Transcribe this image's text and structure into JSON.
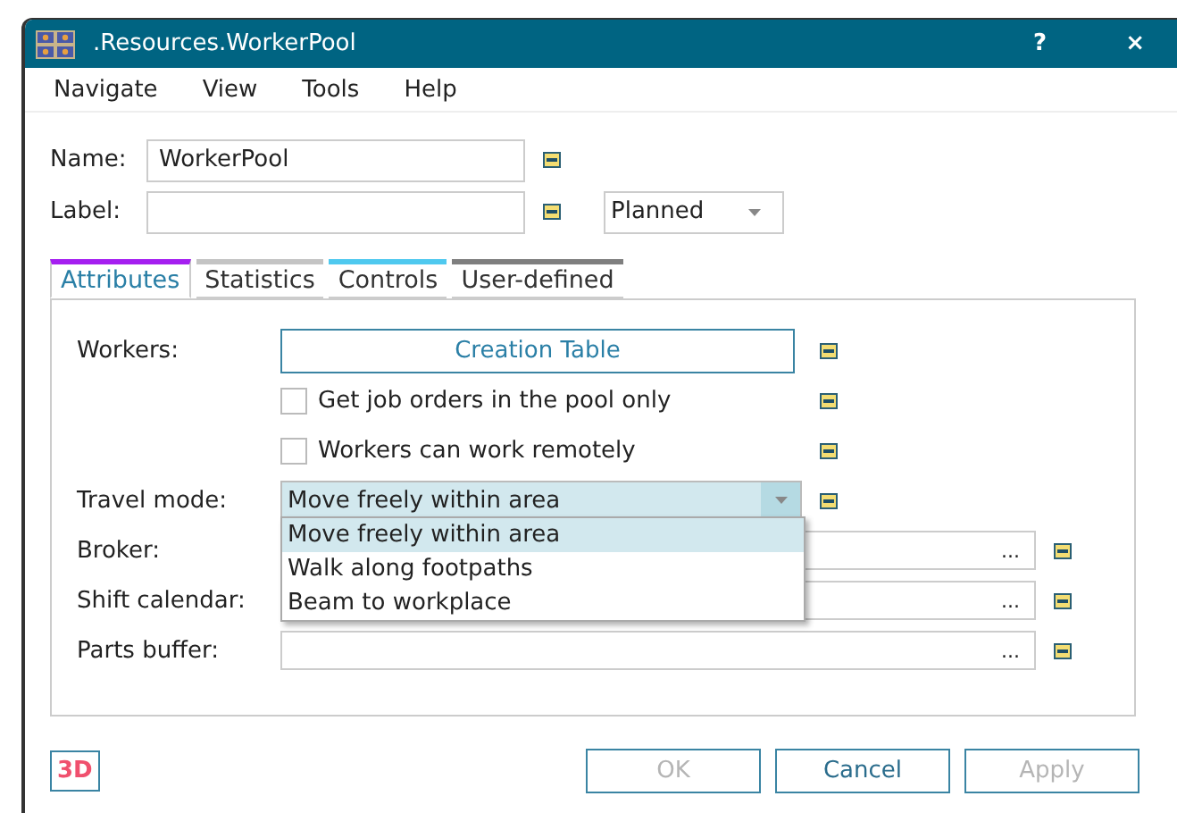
{
  "window": {
    "title": ".Resources.WorkerPool",
    "buttons": [
      "?",
      "×"
    ]
  },
  "menu": [
    "Navigate",
    "View",
    "Tools",
    "Help"
  ],
  "name_field": {
    "label": "Name:",
    "value": "WorkerPool"
  },
  "label_field": {
    "label": "Label:"
  },
  "state_select": {
    "value": "Planned"
  },
  "tabs": [
    {
      "label": "Attributes",
      "selected": true,
      "color": "#a51ff0"
    },
    {
      "label": "Statistics",
      "selected": false,
      "color": "#c4c4c4"
    },
    {
      "label": "Controls",
      "selected": false,
      "color": "#4fc9ef"
    },
    {
      "label": "User-defined",
      "selected": false,
      "color": "#7f7f7f"
    }
  ],
  "attributes": [
    {
      "kind": "button",
      "label": "Workers:",
      "text": "Creation Table"
    },
    {
      "kind": "checkbox",
      "text": "Get job orders in the pool only",
      "checked": false
    },
    {
      "kind": "checkbox",
      "text": "Workers can work remotely",
      "checked": false
    },
    {
      "kind": "select",
      "label": "Travel mode:",
      "value": "Move freely within area",
      "open": true
    },
    {
      "kind": "browse",
      "label": "Broker:",
      "button": "..."
    },
    {
      "kind": "browse",
      "label": "Shift calendar:",
      "button": "..."
    },
    {
      "kind": "browse",
      "label": "Parts buffer:",
      "button": "..."
    }
  ],
  "dropdown_options": [
    {
      "label": "Move freely within area",
      "selected": true
    },
    {
      "label": "Walk along footpaths",
      "selected": false
    },
    {
      "label": "Beam to workplace",
      "selected": false
    }
  ],
  "badge": "3D",
  "buttons": [
    {
      "label": "OK",
      "disabled": true
    },
    {
      "label": "Cancel",
      "disabled": false
    },
    {
      "label": "Apply",
      "disabled": true
    }
  ]
}
